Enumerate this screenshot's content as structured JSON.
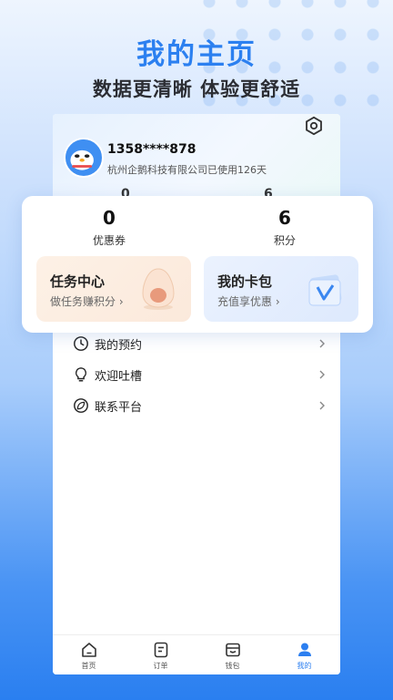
{
  "promo": {
    "title": "我的主页",
    "subtitle": "数据更清晰 体验更舒适"
  },
  "profile": {
    "phone": "1358****878",
    "company_text": "杭州企鹅科技有限公司已使用126天",
    "peek_left": "0",
    "peek_right": "6"
  },
  "stats": [
    {
      "value": "0",
      "label": "优惠券"
    },
    {
      "value": "6",
      "label": "积分"
    }
  ],
  "tiles": [
    {
      "title": "任务中心",
      "subtitle": "做任务赚积分 ›"
    },
    {
      "title": "我的卡包",
      "subtitle": "充值享优惠 ›"
    }
  ],
  "menu": [
    {
      "label": "我的预约",
      "icon": "clock-icon"
    },
    {
      "label": "欢迎吐槽",
      "icon": "lightbulb-icon"
    },
    {
      "label": "联系平台",
      "icon": "leaf-icon"
    }
  ],
  "tabs": [
    {
      "label": "首页",
      "icon": "home-icon"
    },
    {
      "label": "订单",
      "icon": "order-icon"
    },
    {
      "label": "钱包",
      "icon": "wallet-icon"
    },
    {
      "label": "我的",
      "icon": "user-icon",
      "active": true
    }
  ],
  "colors": {
    "accent": "#2c80f0",
    "task_tile": "#fdf1e6",
    "card_tile": "#ebf2fe"
  }
}
